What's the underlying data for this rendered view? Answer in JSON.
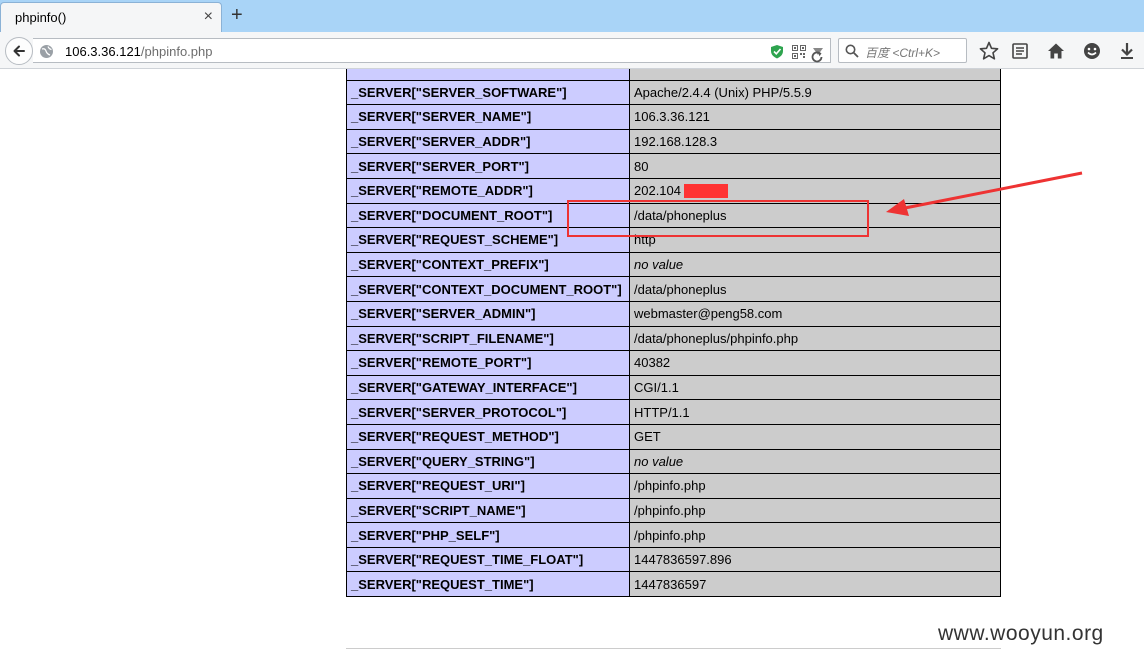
{
  "browser": {
    "tab": {
      "title": "phpinfo()",
      "close_glyph": "×"
    },
    "new_tab_glyph": "+",
    "url": {
      "host": "106.3.36.121",
      "path": "/phpinfo.php"
    },
    "search": {
      "placeholder": "百度 <Ctrl+K>"
    }
  },
  "server_vars": [
    {
      "key": "_SERVER[\"SERVER_SOFTWARE\"]",
      "value": "Apache/2.4.4 (Unix) PHP/5.5.9"
    },
    {
      "key": "_SERVER[\"SERVER_NAME\"]",
      "value": "106.3.36.121"
    },
    {
      "key": "_SERVER[\"SERVER_ADDR\"]",
      "value": "192.168.128.3"
    },
    {
      "key": "_SERVER[\"SERVER_PORT\"]",
      "value": "80"
    },
    {
      "key": "_SERVER[\"REMOTE_ADDR\"]",
      "value": "202.104"
    },
    {
      "key": "_SERVER[\"DOCUMENT_ROOT\"]",
      "value": "/data/phoneplus"
    },
    {
      "key": "_SERVER[\"REQUEST_SCHEME\"]",
      "value": "http"
    },
    {
      "key": "_SERVER[\"CONTEXT_PREFIX\"]",
      "value": "no value"
    },
    {
      "key": "_SERVER[\"CONTEXT_DOCUMENT_ROOT\"]",
      "value": "/data/phoneplus"
    },
    {
      "key": "_SERVER[\"SERVER_ADMIN\"]",
      "value": "webmaster@peng58.com"
    },
    {
      "key": "_SERVER[\"SCRIPT_FILENAME\"]",
      "value": "/data/phoneplus/phpinfo.php"
    },
    {
      "key": "_SERVER[\"REMOTE_PORT\"]",
      "value": "40382"
    },
    {
      "key": "_SERVER[\"GATEWAY_INTERFACE\"]",
      "value": "CGI/1.1"
    },
    {
      "key": "_SERVER[\"SERVER_PROTOCOL\"]",
      "value": "HTTP/1.1"
    },
    {
      "key": "_SERVER[\"REQUEST_METHOD\"]",
      "value": "GET"
    },
    {
      "key": "_SERVER[\"QUERY_STRING\"]",
      "value": "no value"
    },
    {
      "key": "_SERVER[\"REQUEST_URI\"]",
      "value": "/phpinfo.php"
    },
    {
      "key": "_SERVER[\"SCRIPT_NAME\"]",
      "value": "/phpinfo.php"
    },
    {
      "key": "_SERVER[\"PHP_SELF\"]",
      "value": "/phpinfo.php"
    },
    {
      "key": "_SERVER[\"REQUEST_TIME_FLOAT\"]",
      "value": "1447836597.896"
    },
    {
      "key": "_SERVER[\"REQUEST_TIME\"]",
      "value": "1447836597"
    }
  ],
  "annotations": {
    "highlight_color": "#ee3333",
    "redaction_color": "#ff3333"
  },
  "watermark": "www.wooyun.org"
}
